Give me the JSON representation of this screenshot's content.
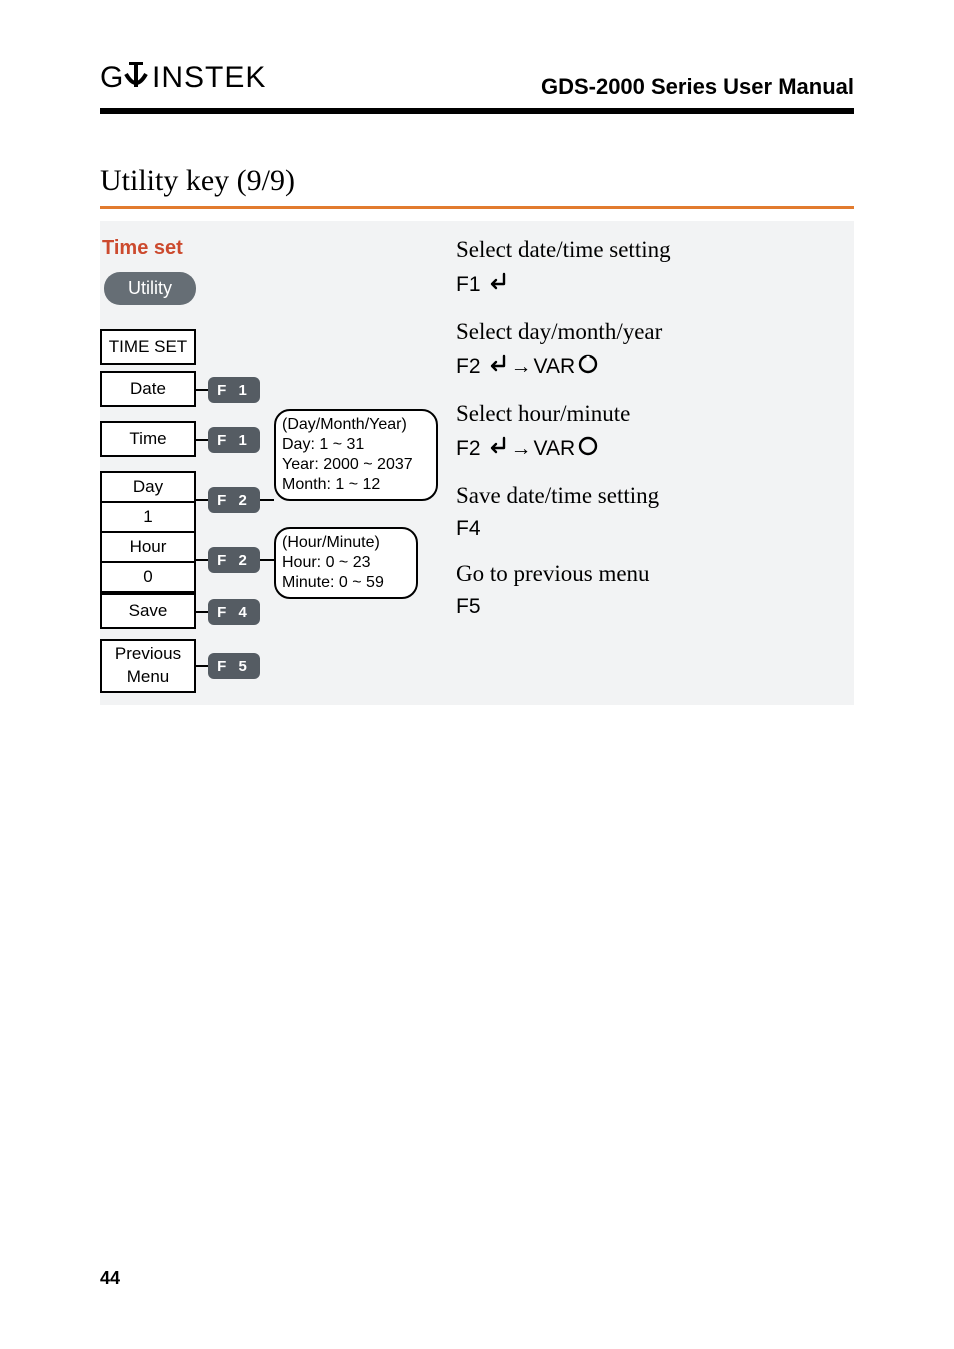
{
  "header": {
    "brand": "GWINSTEK",
    "doc_title": "GDS-2000 Series User Manual"
  },
  "section": {
    "title": "Utility key (9/9)"
  },
  "left": {
    "time_set_label": "Time set",
    "utility_button": "Utility",
    "softkeys": {
      "timeset": "TIME SET",
      "date": "Date",
      "time": "Time",
      "day_label": "Day",
      "day_value": "1",
      "hour_label": "Hour",
      "hour_value": "0",
      "save": "Save",
      "prev_l1": "Previous",
      "prev_l2": "Menu"
    },
    "fkeys": {
      "f1a": "F 1",
      "f1b": "F 1",
      "f2a": "F 2",
      "f2b": "F 2",
      "f4": "F 4",
      "f5": "F 5"
    },
    "bubbles": {
      "date_l1": "(Day/Month/Year)",
      "date_l2": "Day: 1 ~ 31",
      "date_l3": "Year: 2000 ~ 2037",
      "date_l4": "Month: 1 ~ 12",
      "time_l1": "(Hour/Minute)",
      "time_l2": "Hour: 0 ~ 23",
      "time_l3": "Minute: 0 ~ 59"
    }
  },
  "right": {
    "r1": "Select date/time setting",
    "k1": "F1",
    "r2": "Select day/month/year",
    "k2a": "F2",
    "k2arrow": "→",
    "k2b": "VAR",
    "r3": "Select hour/minute",
    "k3a": "F2",
    "k3arrow": "→",
    "k3b": "VAR",
    "r4": "Save date/time setting",
    "k4": "F4",
    "r5": "Go to previous menu",
    "k5": "F5"
  },
  "page_number": "44"
}
